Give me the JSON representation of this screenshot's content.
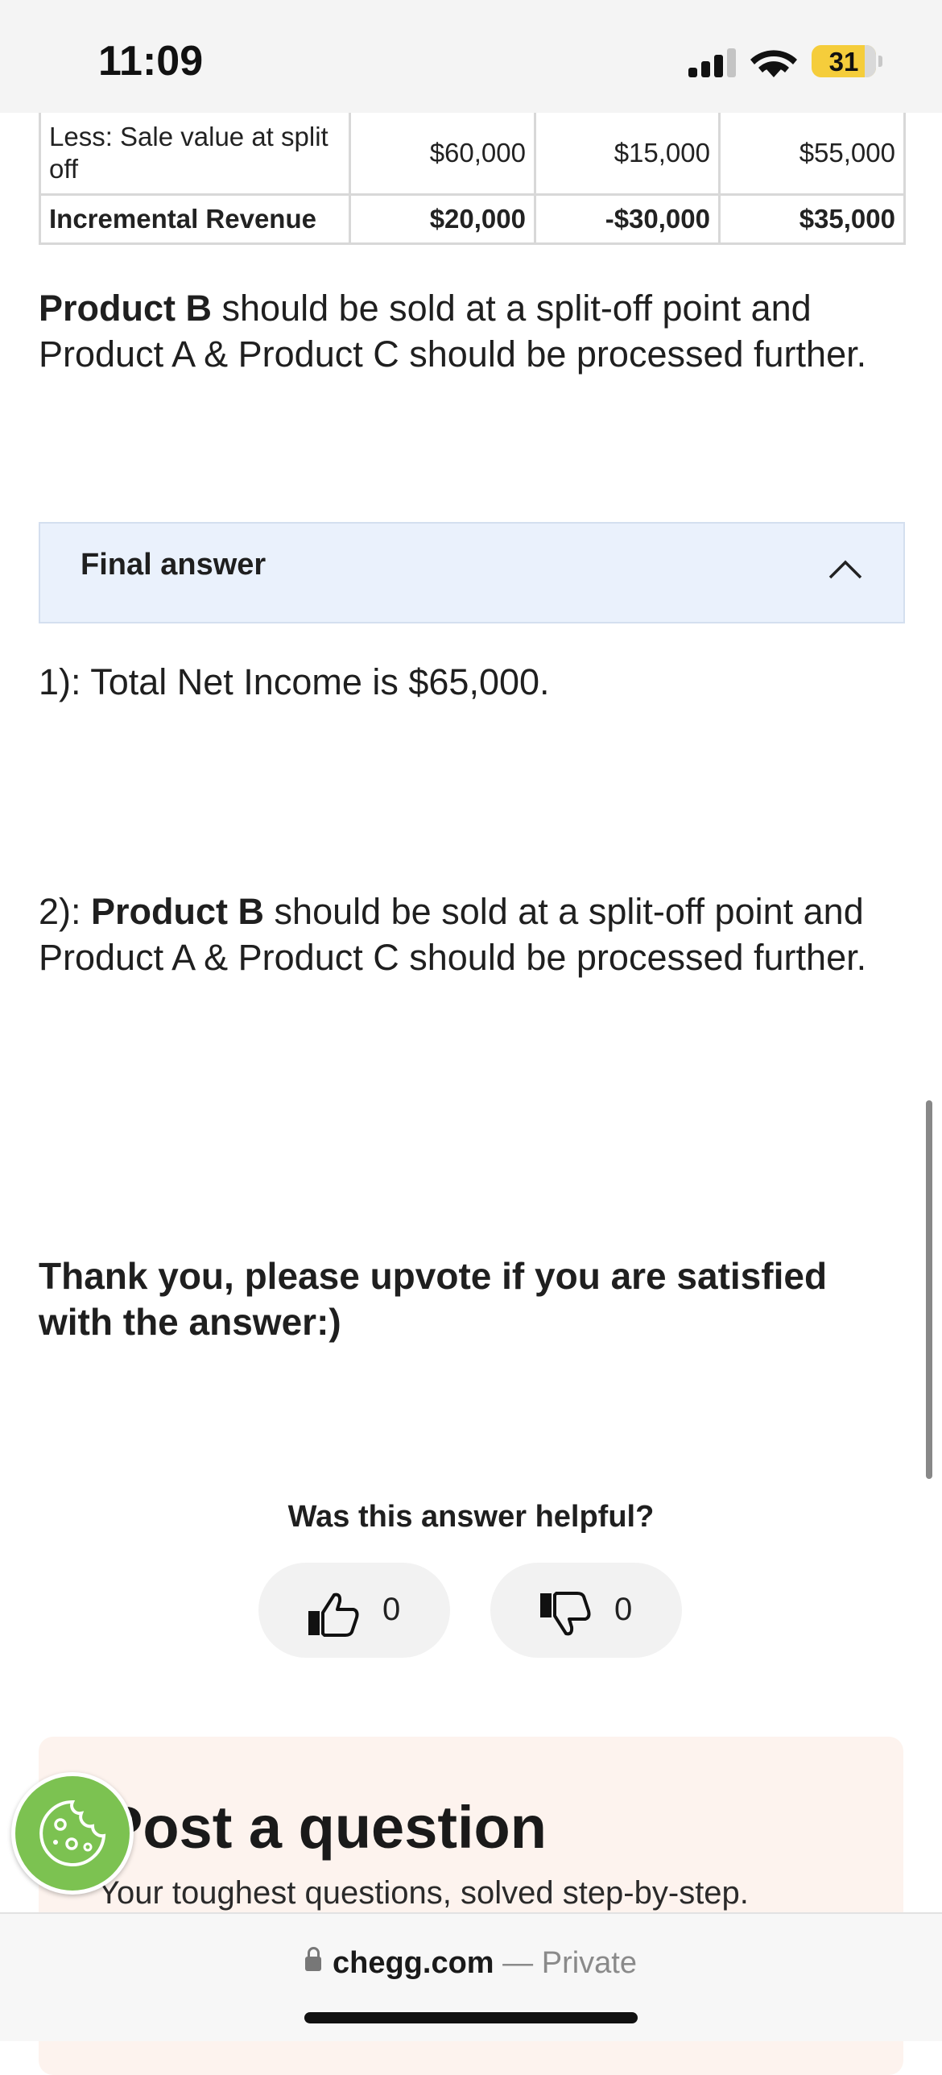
{
  "status_bar": {
    "time": "11:09",
    "battery": "31"
  },
  "table": {
    "rows": [
      {
        "label": "Less: Sale value at split off",
        "values": [
          "$60,000",
          "$15,000",
          "$55,000"
        ]
      },
      {
        "label": "Incremental Revenue",
        "values": [
          "$20,000",
          "-$30,000",
          "$35,000"
        ]
      }
    ]
  },
  "conclusion": {
    "bold": "Product B",
    "rest": " should be sold at a split-off point and Product A & Product C should be processed further."
  },
  "final_answer": {
    "title": "Final answer",
    "answer1": "1): Total Net Income is $65,000.",
    "answer2_prefix": "2): ",
    "answer2_bold": "Product B",
    "answer2_rest": " should be sold at a split-off point and Product A & Product C should be processed further."
  },
  "thanks": "Thank you, please upvote if you are satisfied with the answer:)",
  "feedback": {
    "question": "Was this answer helpful?",
    "up_count": "0",
    "down_count": "0"
  },
  "post_card": {
    "title": "Post a question",
    "subtitle": "Your toughest questions, solved step-by-step."
  },
  "browser": {
    "domain": "chegg.com",
    "separator": " — ",
    "mode": "Private"
  },
  "colors": {
    "cookie_button": "#7cc251",
    "final_box": "#eaf1fc",
    "post_card": "#fdf3ee",
    "battery": "#f5cd3b"
  }
}
